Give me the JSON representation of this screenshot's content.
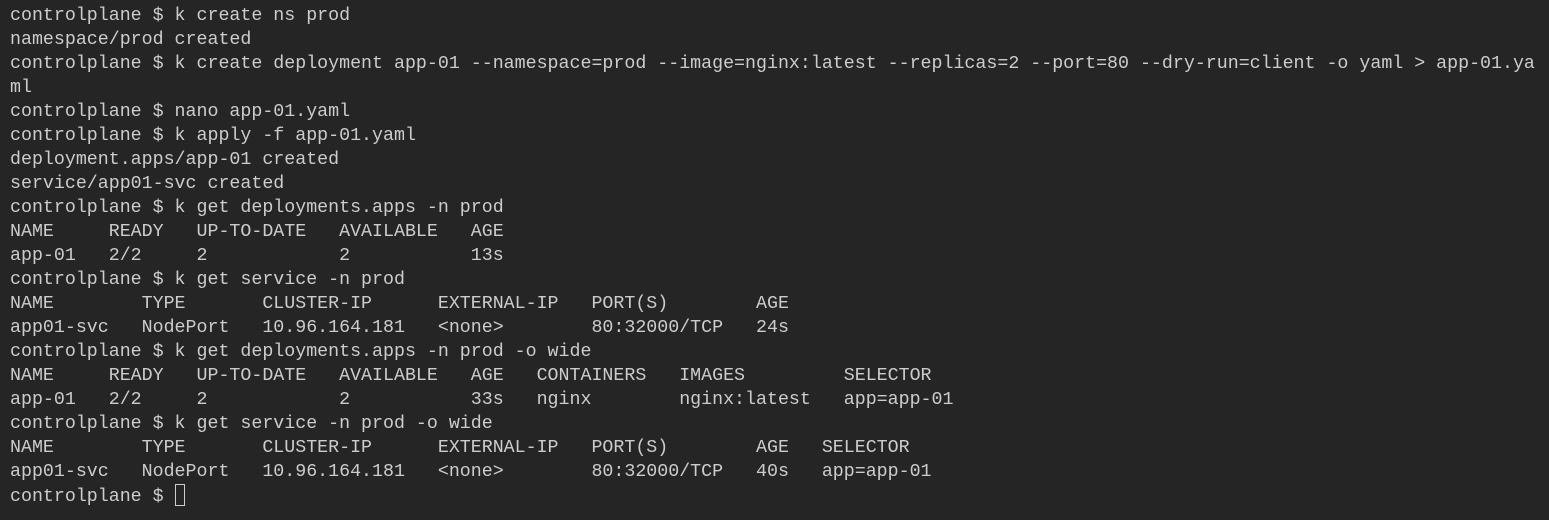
{
  "terminal": {
    "lines": [
      "controlplane $ k create ns prod",
      "namespace/prod created",
      "controlplane $ k create deployment app-01 --namespace=prod --image=nginx:latest --replicas=2 --port=80 --dry-run=client -o yaml > app-01.ya",
      "ml",
      "controlplane $ nano app-01.yaml",
      "controlplane $ k apply -f app-01.yaml",
      "deployment.apps/app-01 created",
      "service/app01-svc created",
      "controlplane $ k get deployments.apps -n prod",
      "NAME     READY   UP-TO-DATE   AVAILABLE   AGE",
      "app-01   2/2     2            2           13s",
      "controlplane $ k get service -n prod",
      "NAME        TYPE       CLUSTER-IP      EXTERNAL-IP   PORT(S)        AGE",
      "app01-svc   NodePort   10.96.164.181   <none>        80:32000/TCP   24s",
      "controlplane $ k get deployments.apps -n prod -o wide",
      "NAME     READY   UP-TO-DATE   AVAILABLE   AGE   CONTAINERS   IMAGES         SELECTOR",
      "app-01   2/2     2            2           33s   nginx        nginx:latest   app=app-01",
      "controlplane $ k get service -n prod -o wide",
      "NAME        TYPE       CLUSTER-IP      EXTERNAL-IP   PORT(S)        AGE   SELECTOR",
      "app01-svc   NodePort   10.96.164.181   <none>        80:32000/TCP   40s   app=app-01"
    ],
    "prompt": "controlplane $ "
  }
}
